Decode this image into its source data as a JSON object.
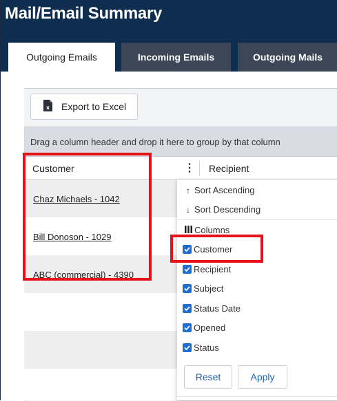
{
  "header": {
    "title": "Mail/Email Summary"
  },
  "tabs": [
    {
      "label": "Outgoing Emails",
      "active": true
    },
    {
      "label": "Incoming Emails",
      "active": false
    },
    {
      "label": "Outgoing Mails",
      "active": false
    }
  ],
  "toolbar": {
    "export_label": "Export to Excel"
  },
  "grid": {
    "group_hint": "Drag a column header and drop it here to group by that column",
    "columns": [
      "Customer",
      "Recipient"
    ],
    "rows": [
      {
        "customer": "Chaz Michaels - 1042"
      },
      {
        "customer": "Bill Donoson - 1029"
      },
      {
        "customer": "ABC (commercial) - 4390"
      }
    ]
  },
  "column_menu": {
    "sort_asc": "Sort Ascending",
    "sort_desc": "Sort Descending",
    "columns_label": "Columns",
    "columns": [
      {
        "label": "Customer",
        "checked": true
      },
      {
        "label": "Recipient",
        "checked": true
      },
      {
        "label": "Subject",
        "checked": true
      },
      {
        "label": "Status Date",
        "checked": true
      },
      {
        "label": "Opened",
        "checked": true
      },
      {
        "label": "Status",
        "checked": true
      }
    ],
    "reset_label": "Reset",
    "apply_label": "Apply"
  },
  "colors": {
    "header_bg": "#0f2d4e",
    "tab_inactive": "#3b4656",
    "accent": "#1f6fd1",
    "highlight": "#e8101b"
  }
}
